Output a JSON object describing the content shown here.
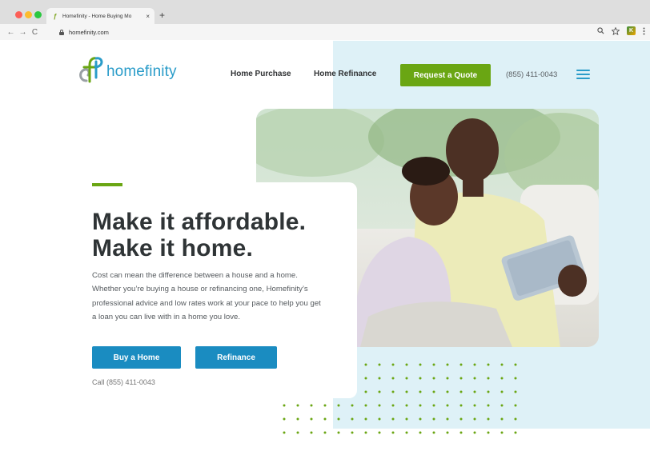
{
  "browser": {
    "tab_title": "Homefinity - Home Buying Mo",
    "tab_close": "×",
    "new_tab": "+",
    "url": "homefinity.com",
    "nav_back": "←",
    "nav_forward": "→",
    "nav_reload": "C",
    "ext_label": "K"
  },
  "header": {
    "logo_text": "homefinity",
    "nav": [
      "Home Purchase",
      "Home Refinance"
    ],
    "cta": "Request a Quote",
    "phone": "(855) 411-0043"
  },
  "hero": {
    "headline_line1": "Make it affordable.",
    "headline_line2": "Make it home.",
    "body": "Cost can mean the difference between a house and a home. Whether you’re buying a house or refinancing one, Homefinity’s professional advice and low rates work at your pace to help you get a loan you can live with in a home you love.",
    "buttons": [
      "Buy a Home",
      "Refinance"
    ],
    "call": "Call (855) 411-0043"
  },
  "colors": {
    "brand_blue": "#2a9cc9",
    "brand_green": "#6aa613",
    "button_blue": "#1a8cc1",
    "hero_bg": "#def1f7"
  }
}
